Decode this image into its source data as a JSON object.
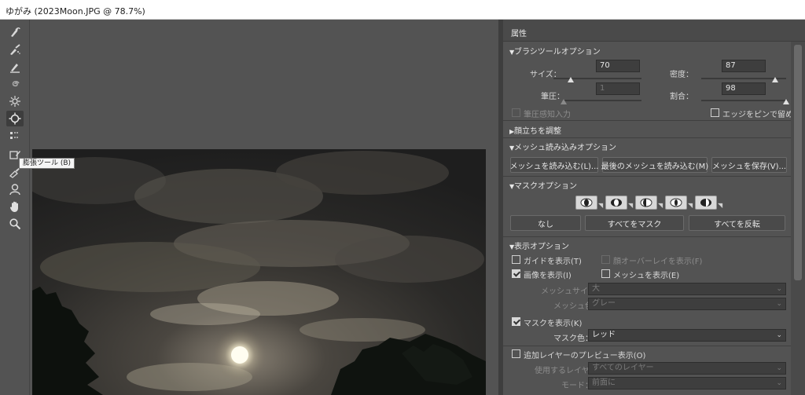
{
  "window": {
    "title": "ゆがみ (2023Moon.JPG @ 78.7%)"
  },
  "toolbar": {
    "tools": [
      "forward-warp-icon",
      "reconstruct-icon",
      "smooth-icon",
      "twirl-icon",
      "pucker-icon",
      "bloat-icon",
      "push-left-icon",
      "freeze-mask-icon",
      "thaw-mask-icon",
      "face-tool-icon",
      "hand-icon",
      "zoom-icon"
    ],
    "tooltip": "膨張ツール (B)"
  },
  "panel": {
    "tab_label": "属性",
    "brush": {
      "header": "ブラシツールオプション",
      "size_label": "サイズ：",
      "size_value": "70",
      "size_level": 0.2,
      "density_label": "密度：",
      "density_value": "87",
      "density_level": 0.87,
      "pressure_label": "筆圧：",
      "pressure_value": "1",
      "pressure_level": 0.01,
      "rate_label": "割合：",
      "rate_value": "98",
      "rate_level": 0.98,
      "stylus_label": "筆圧感知入力",
      "pin_edges_label": "エッジをピンで留める"
    },
    "face": {
      "header": "顔立ちを調整"
    },
    "mesh": {
      "header": "メッシュ読み込みオプション",
      "load_label": "メッシュを読み込む(L)...",
      "load_last_label": "最後のメッシュを読み込む(M)",
      "save_label": "メッシュを保存(V)..."
    },
    "mask": {
      "header": "マスクオプション",
      "none_label": "なし",
      "mask_all_label": "すべてをマスク",
      "invert_all_label": "すべてを反転"
    },
    "view": {
      "header": "表示オプション",
      "show_guides_label": "ガイドを表示(T)",
      "face_overlay_label": "顔オーバーレイを表示(F)",
      "show_image_label": "画像を表示(I)",
      "show_mesh_label": "メッシュを表示(E)",
      "mesh_size_label": "メッシュサイズ：",
      "mesh_size_value": "大",
      "mesh_color_label": "メッシュ色：",
      "mesh_color_value": "グレー",
      "show_mask_label": "マスクを表示(K)",
      "mask_color_label": "マスク色：",
      "mask_color_value": "レッド",
      "backdrop_label": "追加レイヤーのプレビュー表示(O)",
      "use_layer_label": "使用するレイヤー：",
      "use_layer_value": "すべてのレイヤー",
      "mode_label": "モード：",
      "mode_value": "前面に"
    }
  }
}
